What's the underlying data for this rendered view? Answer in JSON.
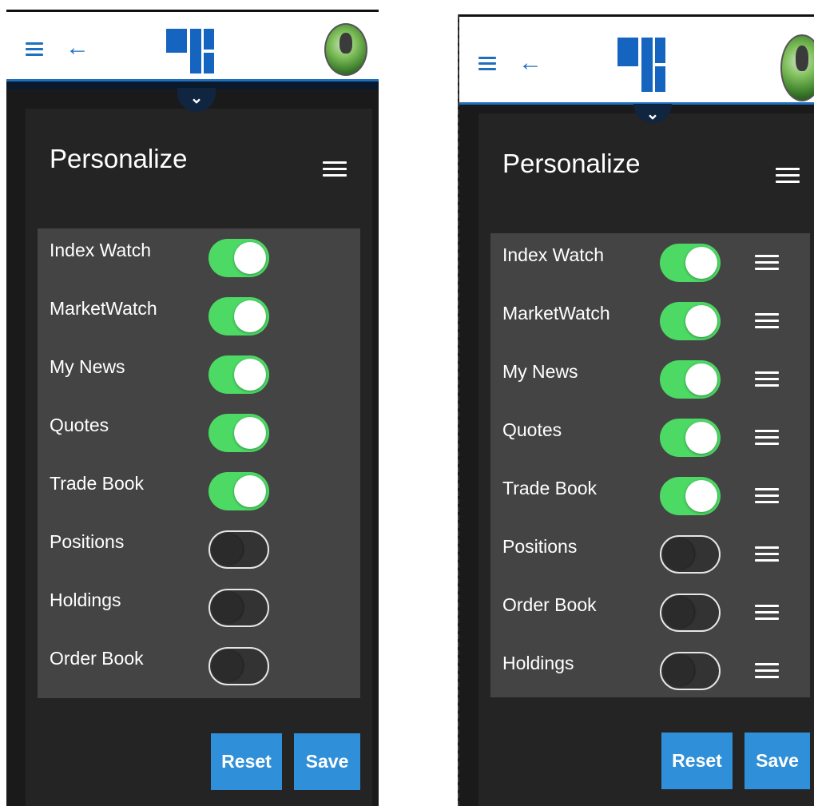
{
  "colors": {
    "accent": "#1f6fbf",
    "toggle_on": "#4cd964",
    "button": "#2f8fd8",
    "panel": "#242424",
    "list_bg": "#444444"
  },
  "left": {
    "title": "Personalize",
    "items": [
      {
        "label": "Index Watch",
        "enabled": true
      },
      {
        "label": "MarketWatch",
        "enabled": true
      },
      {
        "label": "My News",
        "enabled": true
      },
      {
        "label": "Quotes",
        "enabled": true
      },
      {
        "label": "Trade Book",
        "enabled": true
      },
      {
        "label": "Positions",
        "enabled": false
      },
      {
        "label": "Holdings",
        "enabled": false
      },
      {
        "label": "Order Book",
        "enabled": false
      }
    ],
    "reset_label": "Reset",
    "save_label": "Save"
  },
  "right": {
    "title": "Personalize",
    "items": [
      {
        "label": "Index Watch",
        "enabled": true
      },
      {
        "label": "MarketWatch",
        "enabled": true
      },
      {
        "label": "My News",
        "enabled": true
      },
      {
        "label": "Quotes",
        "enabled": true
      },
      {
        "label": "Trade Book",
        "enabled": true
      },
      {
        "label": "Positions",
        "enabled": false
      },
      {
        "label": "Order Book",
        "enabled": false
      },
      {
        "label": "Holdings",
        "enabled": false
      }
    ],
    "reset_label": "Reset",
    "save_label": "Save"
  },
  "icons": {
    "menu": "hamburger-icon",
    "back": "back-arrow-icon",
    "logo": "app-logo",
    "voice": "microphone-icon",
    "collapse": "chevron-down-icon",
    "reorder": "drag-handle-icon"
  }
}
